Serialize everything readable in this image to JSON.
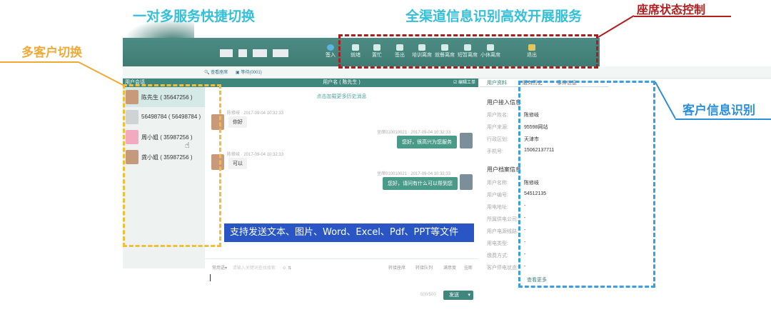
{
  "annotations": {
    "one_to_many": "一对多服务快捷切换",
    "omni_channel": "全渠道信息识别高效开展服务",
    "seat_status": "座席状态控制",
    "multi_customer": "多客户切换",
    "customer_info": "客户信息识别",
    "feature_banner": "支持发送文本、图片、Word、Excel、Pdf、PPT等文件"
  },
  "toolbar": {
    "signin": "签入",
    "buttons": [
      "就绪",
      "置忙",
      "签出",
      "培训离席",
      "就餐离席",
      "短暂离席",
      "小休离席"
    ],
    "logout": "退出"
  },
  "subbar": {
    "view_seats": "查看座席",
    "waiting": "等待(0001)"
  },
  "conversations": {
    "header": "用户会话",
    "items": [
      {
        "name": "陈先生 ( 35647256 )",
        "active": true
      },
      {
        "name": "56498784 ( 56498784 )",
        "active": false
      },
      {
        "name": "周小姐 ( 35987256 )",
        "active": false
      },
      {
        "name": "龚小姐 ( 35987256 )",
        "active": false
      }
    ]
  },
  "chat": {
    "header": "用户名 ( 陈先生 )",
    "work_order": "编辑工单",
    "load_more": "点击加载更多历史消息",
    "messages": [
      {
        "side": "left",
        "meta": "陈修岐 · 2017-09-04 10:32:33",
        "text": "你好"
      },
      {
        "side": "right",
        "meta": "坐席010010021 · 2017-09-04 10:32:33",
        "text": "您好，很高兴为您服务"
      },
      {
        "side": "left",
        "meta": "陈修岐 · 2017-09-04 10:32:33",
        "text": "可以"
      },
      {
        "side": "right",
        "meta": "坐席010010021 · 2017-09-04 10:32:33",
        "text": "您好，请问有什么可以帮到您"
      }
    ]
  },
  "input": {
    "quick_phrase": "常用语▾",
    "placeholder": "请输入关键词查找搜索",
    "icons": "☺ ⇅",
    "actions": [
      "转接座席",
      "转接队列",
      "满意度",
      "挂断"
    ],
    "counter": "500/500",
    "send": "发送",
    "send_dropdown": "▾"
  },
  "info": {
    "tabs": [
      "用户资料",
      "服务历史",
      "事件信息"
    ],
    "access_title": "用户接入信息",
    "access_fields": [
      {
        "label": "用户姓名:",
        "value": "陈修岐"
      },
      {
        "label": "用户来源:",
        "value": "95598网站"
      },
      {
        "label": "行政区划:",
        "value": "天津市"
      },
      {
        "label": "手机号:",
        "value": "15062137711"
      }
    ],
    "archive_title": "用户档案信息",
    "archive_fields": [
      {
        "label": "用户名称:",
        "value": "陈修岐"
      },
      {
        "label": "用户编号:",
        "value": "54512135"
      },
      {
        "label": "用电地址:",
        "value": "-"
      },
      {
        "label": "所属供电公司:",
        "value": "-"
      },
      {
        "label": "用户电源线路:",
        "value": "-"
      },
      {
        "label": "用电类型:",
        "value": "-"
      },
      {
        "label": "缴费方式:",
        "value": "-"
      },
      {
        "label": "客户停电状态:",
        "value": "-"
      }
    ],
    "more": "查看更多"
  }
}
